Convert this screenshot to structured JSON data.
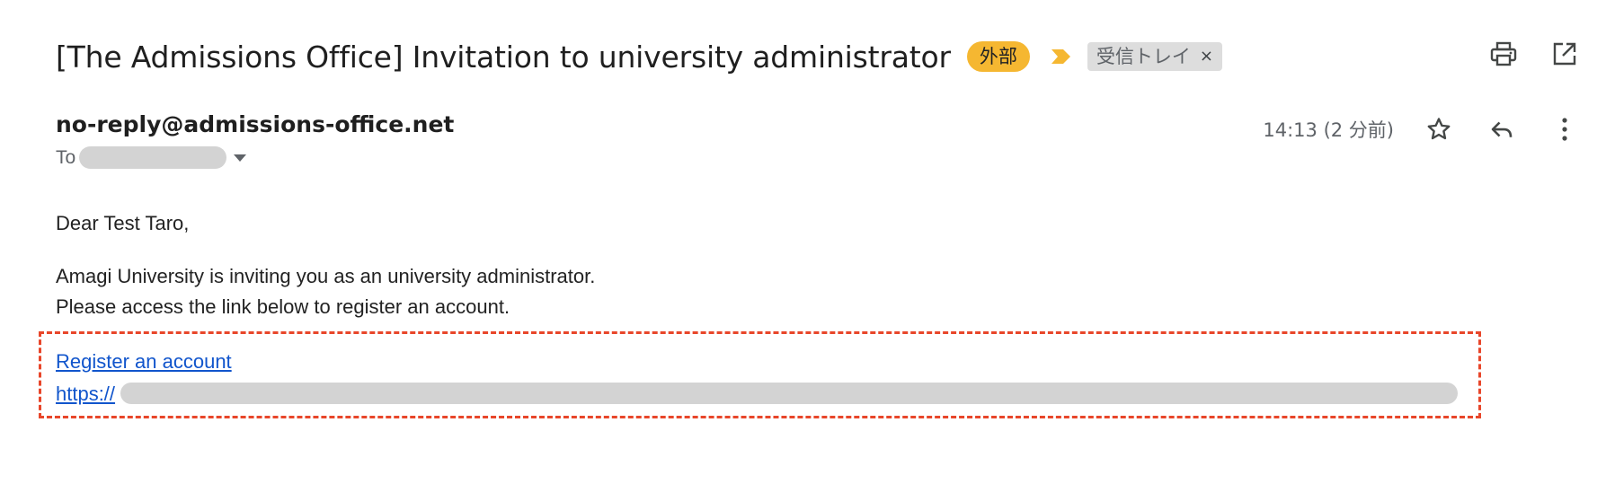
{
  "email": {
    "subject": "[The Admissions Office] Invitation to university administrator",
    "badge_external": "外部",
    "label_inbox": "受信トレイ",
    "label_remove": "×",
    "sender": "no-reply@admissions-office.net",
    "to_label": "To",
    "timestamp": "14:13 (2 分前)",
    "greeting": "Dear Test Taro,",
    "body_line1": "Amagi University is inviting you as an university administrator.",
    "body_line2": "Please access the link below to register an account.",
    "link_text": "Register an account",
    "url_prefix": "https://"
  },
  "icons": {
    "importance": "importance-marker-icon",
    "print": "print-icon",
    "open_new_window": "open-in-new-window-icon",
    "star": "star-icon",
    "reply": "reply-icon",
    "more": "more-vertical-icon",
    "recipients_dropdown": "chevron-down-icon"
  },
  "colors": {
    "external_badge": "#f5b731",
    "importance_marker": "#f5b731",
    "link": "#1155cc",
    "highlight_border": "#e8462a",
    "redaction": "#d3d3d3"
  }
}
